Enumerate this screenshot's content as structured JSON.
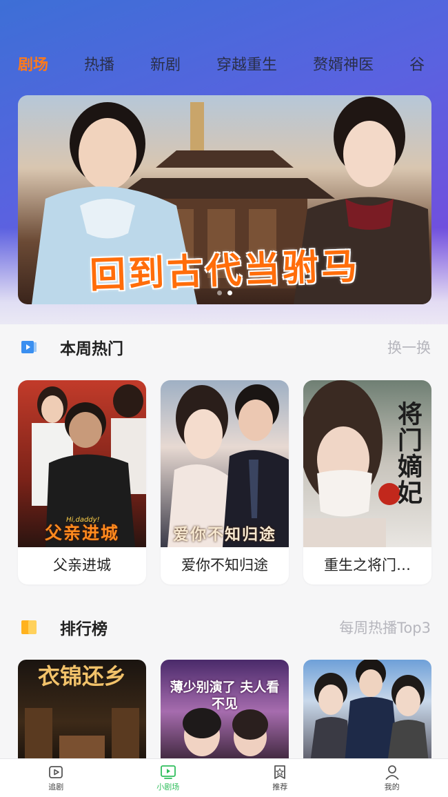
{
  "tabs": [
    "剧场",
    "热播",
    "新剧",
    "穿越重生",
    "赘婿神医",
    "谷"
  ],
  "banner": {
    "title": "回到古代当驸马",
    "dots": 2
  },
  "weekly_hot": {
    "title": "本周热门",
    "more": "换一换",
    "items": [
      {
        "label": "父亲进城",
        "poster_title": "父亲进城",
        "poster_sub": "Hi,daddy!"
      },
      {
        "label": "爱你不知归途",
        "poster_title": "爱你不知归途"
      },
      {
        "label": "重生之将门…",
        "poster_title": "将门嫡妃"
      }
    ]
  },
  "ranking": {
    "title": "排行榜",
    "more": "每周热播Top3",
    "items": [
      {
        "poster_title": "衣锦还乡"
      },
      {
        "poster_title": "薄少别演了 夫人看不见"
      },
      {
        "poster_title": ""
      }
    ]
  },
  "nav": [
    {
      "label": "追剧",
      "icon": "play-box-icon"
    },
    {
      "label": "小剧场",
      "icon": "tv-icon"
    },
    {
      "label": "推荐",
      "icon": "star-badge-icon"
    },
    {
      "label": "我的",
      "icon": "user-icon"
    }
  ],
  "colors": {
    "accent": "#ff7a1a",
    "nav_active": "#2fbe5c",
    "section_icon_blue": "#3a8ff0",
    "section_icon_orange": "#ffb21f"
  }
}
